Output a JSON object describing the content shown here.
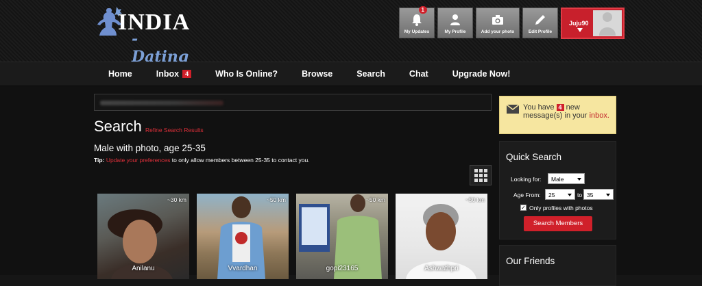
{
  "brand": {
    "line1": "INDIA",
    "line2": "-Dating"
  },
  "top_actions": [
    {
      "label": "My Updates",
      "icon": "bell-icon",
      "badge": "1"
    },
    {
      "label": "My Profile",
      "icon": "person-icon"
    },
    {
      "label": "Add your photo",
      "icon": "camera-icon"
    },
    {
      "label": "Edit Profile",
      "icon": "pencil-icon"
    }
  ],
  "user": {
    "name": "Juju90"
  },
  "nav": [
    {
      "label": "Home"
    },
    {
      "label": "Inbox",
      "badge": "4"
    },
    {
      "label": "Who Is Online?"
    },
    {
      "label": "Browse"
    },
    {
      "label": "Search"
    },
    {
      "label": "Chat"
    },
    {
      "label": "Upgrade Now!"
    }
  ],
  "page": {
    "title": "Search",
    "refine_link": "Refine Search Results",
    "subtitle": "Male with photo, age 25-35",
    "tip_label": "Tip:",
    "tip_link": "Update your preferences",
    "tip_rest": "to only allow members between 25-35 to contact you."
  },
  "members": [
    {
      "name": "Anilanu",
      "distance": "~30 km"
    },
    {
      "name": "Vvardhan",
      "distance": "~50 km"
    },
    {
      "name": "gopi23165",
      "distance": "~50 km"
    },
    {
      "name": "Ashwathpri",
      "distance": "~50 km"
    }
  ],
  "messages": {
    "prefix": "You have",
    "count": "4",
    "middle": "new message(s) in your",
    "link": "inbox."
  },
  "quick_search": {
    "title": "Quick Search",
    "looking_for_label": "Looking for:",
    "looking_for_value": "Male",
    "age_from_label": "Age From:",
    "age_from_value": "25",
    "to_label": "to",
    "age_to_value": "35",
    "checkbox_label": "Only profiles with photos",
    "button": "Search Members"
  },
  "friends": {
    "title": "Our Friends"
  },
  "colors": {
    "accent": "#d0202a",
    "brand_blue": "#7b9fd6",
    "notice_bg": "#f6e6a0"
  }
}
